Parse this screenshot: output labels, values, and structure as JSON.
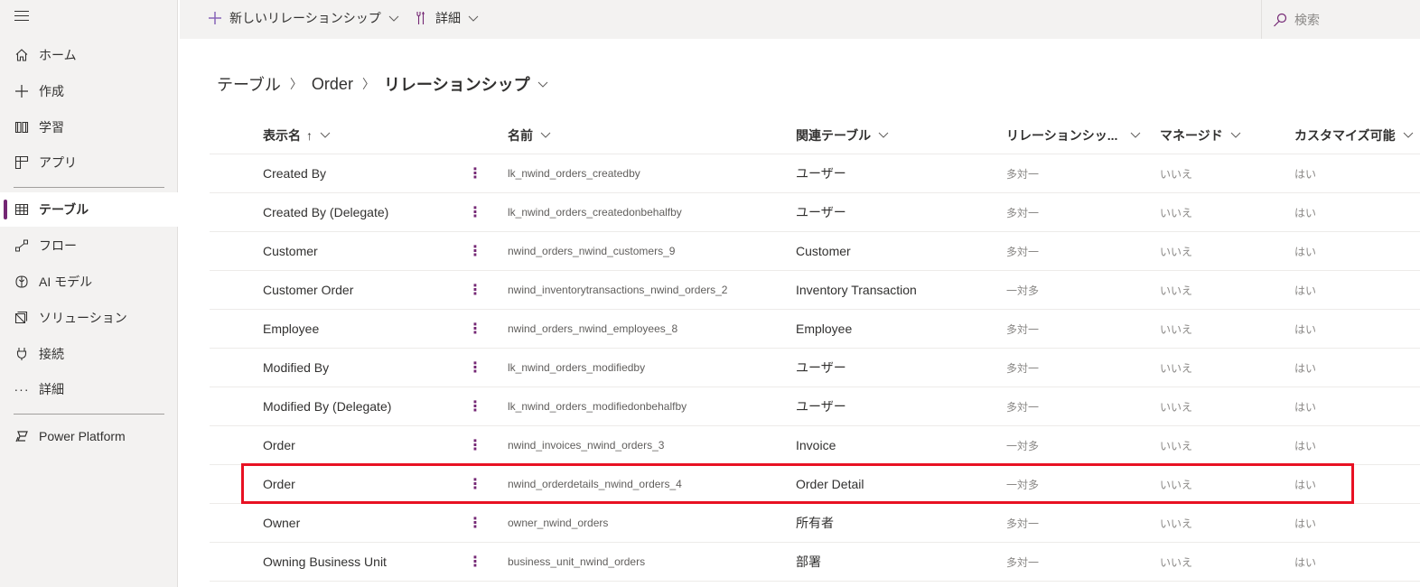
{
  "sidebar": {
    "menu_icon": "hamburger-icon",
    "items": [
      {
        "label": "ホーム",
        "icon": "home-icon",
        "active": false
      },
      {
        "label": "作成",
        "icon": "plus-icon",
        "active": false
      },
      {
        "label": "学習",
        "icon": "book-icon",
        "active": false
      },
      {
        "label": "アプリ",
        "icon": "apps-icon",
        "active": false
      },
      {
        "label": "テーブル",
        "icon": "table-icon",
        "active": true
      },
      {
        "label": "フロー",
        "icon": "flow-icon",
        "active": false
      },
      {
        "label": "AI モデル",
        "icon": "brain-icon",
        "active": false
      },
      {
        "label": "ソリューション",
        "icon": "solution-icon",
        "active": false
      },
      {
        "label": "接続",
        "icon": "plug-icon",
        "active": false
      },
      {
        "label": "詳細",
        "icon": "more-icon",
        "active": false
      },
      {
        "label": "Power Platform",
        "icon": "power-platform-icon",
        "active": false
      }
    ],
    "accent_color": "#742774"
  },
  "commandbar": {
    "new_relationship": "新しいリレーションシップ",
    "advanced": "詳細",
    "search_placeholder": "検索"
  },
  "breadcrumb": {
    "items": [
      "テーブル",
      "Order"
    ],
    "current": "リレーションシップ"
  },
  "table": {
    "columns": [
      {
        "label": "表示名",
        "sorted": "ascending",
        "sort_glyph": "↑"
      },
      {
        "label": "名前"
      },
      {
        "label": "関連テーブル"
      },
      {
        "label": "リレーションシッ..."
      },
      {
        "label": "マネージド"
      },
      {
        "label": "カスタマイズ可能"
      }
    ],
    "rows": [
      {
        "display": "Created By",
        "name": "lk_nwind_orders_createdby",
        "related": "ユーザー",
        "type": "多対一",
        "managed": "いいえ",
        "customizable": "はい"
      },
      {
        "display": "Created By (Delegate)",
        "name": "lk_nwind_orders_createdonbehalfby",
        "related": "ユーザー",
        "type": "多対一",
        "managed": "いいえ",
        "customizable": "はい"
      },
      {
        "display": "Customer",
        "name": "nwind_orders_nwind_customers_9",
        "related": "Customer",
        "type": "多対一",
        "managed": "いいえ",
        "customizable": "はい"
      },
      {
        "display": "Customer Order",
        "name": "nwind_inventorytransactions_nwind_orders_2",
        "related": "Inventory Transaction",
        "type": "一対多",
        "managed": "いいえ",
        "customizable": "はい"
      },
      {
        "display": "Employee",
        "name": "nwind_orders_nwind_employees_8",
        "related": "Employee",
        "type": "多対一",
        "managed": "いいえ",
        "customizable": "はい"
      },
      {
        "display": "Modified By",
        "name": "lk_nwind_orders_modifiedby",
        "related": "ユーザー",
        "type": "多対一",
        "managed": "いいえ",
        "customizable": "はい"
      },
      {
        "display": "Modified By (Delegate)",
        "name": "lk_nwind_orders_modifiedonbehalfby",
        "related": "ユーザー",
        "type": "多対一",
        "managed": "いいえ",
        "customizable": "はい"
      },
      {
        "display": "Order",
        "name": "nwind_invoices_nwind_orders_3",
        "related": "Invoice",
        "type": "一対多",
        "managed": "いいえ",
        "customizable": "はい"
      },
      {
        "display": "Order",
        "name": "nwind_orderdetails_nwind_orders_4",
        "related": "Order Detail",
        "type": "一対多",
        "managed": "いいえ",
        "customizable": "はい",
        "highlighted": true
      },
      {
        "display": "Owner",
        "name": "owner_nwind_orders",
        "related": "所有者",
        "type": "多対一",
        "managed": "いいえ",
        "customizable": "はい"
      },
      {
        "display": "Owning Business Unit",
        "name": "business_unit_nwind_orders",
        "related": "部署",
        "type": "多対一",
        "managed": "いいえ",
        "customizable": "はい"
      }
    ],
    "highlight_color": "#e81123"
  }
}
